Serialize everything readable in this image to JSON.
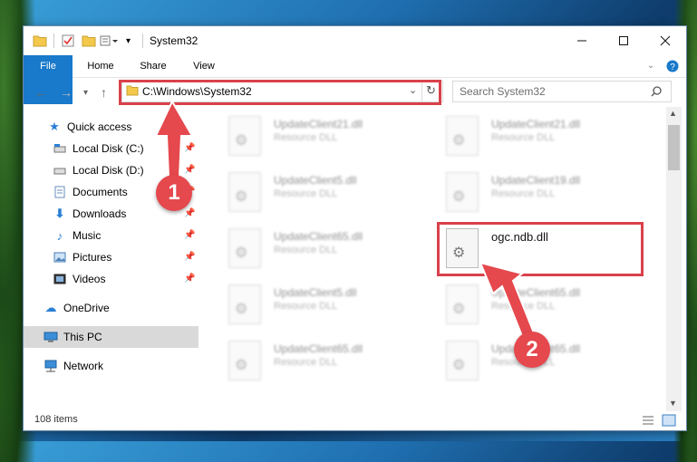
{
  "window": {
    "title": "System32"
  },
  "ribbon": {
    "tabs": [
      "File",
      "Home",
      "Share",
      "View"
    ]
  },
  "address": {
    "path": "C:\\Windows\\System32"
  },
  "search": {
    "placeholder": "Search System32"
  },
  "nav_pane": {
    "items": [
      {
        "label": "Quick access",
        "icon": "star-icon"
      },
      {
        "label": "Local Disk (C:)",
        "icon": "drive-icon",
        "pinned": true
      },
      {
        "label": "Local Disk (D:)",
        "icon": "drive-icon",
        "pinned": true
      },
      {
        "label": "Documents",
        "icon": "documents-icon",
        "pinned": true
      },
      {
        "label": "Downloads",
        "icon": "download-arrow-icon",
        "pinned": true
      },
      {
        "label": "Music",
        "icon": "music-note-icon",
        "pinned": true
      },
      {
        "label": "Pictures",
        "icon": "pictures-icon",
        "pinned": true
      },
      {
        "label": "Videos",
        "icon": "videos-icon",
        "pinned": true
      },
      {
        "label": "OneDrive",
        "icon": "cloud-icon"
      },
      {
        "label": "This PC",
        "icon": "computer-icon",
        "selected": true
      },
      {
        "label": "Network",
        "icon": "network-icon"
      }
    ]
  },
  "files": [
    {
      "name": "UpdateClient21.dll",
      "desc": "Resource DLL"
    },
    {
      "name": "UpdateClient21.dll",
      "desc": "Resource DLL"
    },
    {
      "name": "UpdateClient5.dll",
      "desc": "Resource DLL"
    },
    {
      "name": "UpdateClient19.dll",
      "desc": "Resource DLL"
    },
    {
      "name": "UpdateClient65.dll",
      "desc": "Resource DLL"
    },
    {
      "name": "ogc.ndb.dll",
      "desc": "",
      "highlighted": true
    },
    {
      "name": "UpdateClient5.dll",
      "desc": "Resource DLL"
    },
    {
      "name": "UpdateClient65.dll",
      "desc": "Resource DLL"
    },
    {
      "name": "UpdateClient65.dll",
      "desc": "Resource DLL"
    },
    {
      "name": "UpdateClient65.dll",
      "desc": "Resource DLL"
    }
  ],
  "status": {
    "items_count": "108 items"
  },
  "annotations": {
    "step1": "1",
    "step2": "2",
    "color": "#e5484d"
  }
}
